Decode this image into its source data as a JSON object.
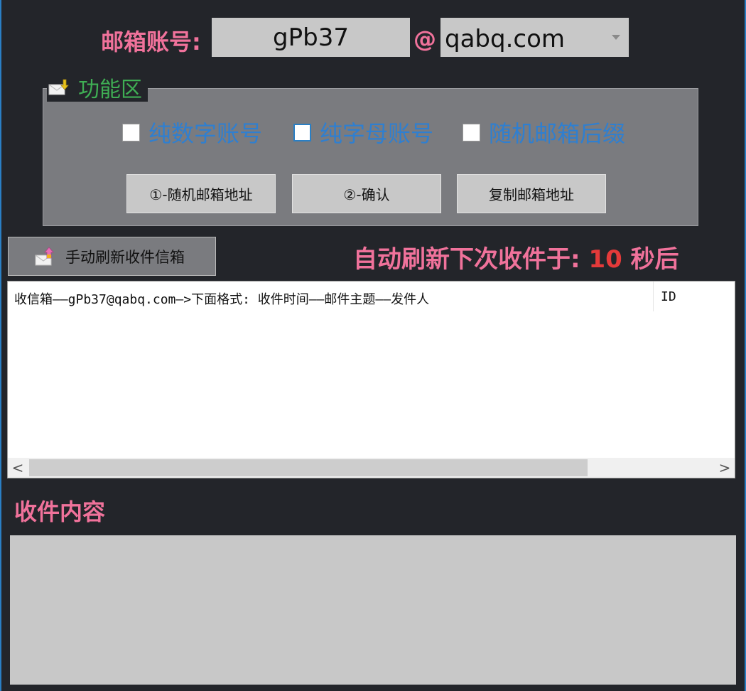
{
  "account": {
    "label": "邮箱账号:",
    "username": "gPb37",
    "at_sign": "@",
    "domain": "qabq.com"
  },
  "function_area": {
    "title": "功能区",
    "options": [
      {
        "label": "纯数字账号",
        "checked": false
      },
      {
        "label": "纯字母账号",
        "checked": false,
        "focused": true
      },
      {
        "label": "随机邮箱后缀",
        "checked": false
      }
    ],
    "buttons": {
      "random_address": "①-随机邮箱地址",
      "confirm": "②-确认",
      "copy_address": "复制邮箱地址"
    }
  },
  "refresh": {
    "manual_button": "手动刷新收件信箱",
    "auto_prefix": "自动刷新下次收件于:",
    "countdown": "10",
    "auto_suffix": "秒后"
  },
  "inbox": {
    "header_main": "收信箱——gPb37@qabq.com—>下面格式: 收件时间——邮件主题——发件人",
    "header_id": "ID",
    "scroll_left": "<",
    "scroll_right": ">"
  },
  "content": {
    "title": "收件内容"
  },
  "colors": {
    "background": "#23252a",
    "accent_pink": "#f0729b",
    "countdown_red": "#e43a3a",
    "option_blue": "#2f7fd0",
    "group_title_green": "#3fae54"
  }
}
